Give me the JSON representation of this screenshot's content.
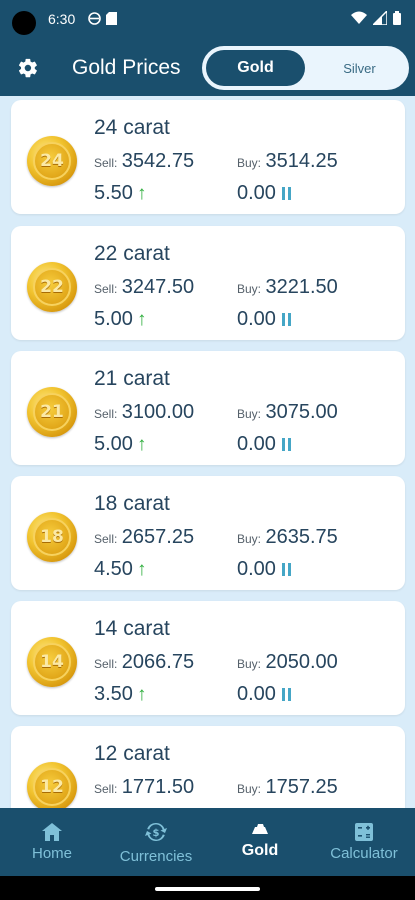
{
  "status_bar": {
    "time": "6:30"
  },
  "app_bar": {
    "title": "Gold Prices",
    "toggle": {
      "gold_label": "Gold",
      "silver_label": "Silver",
      "selected": "Gold"
    }
  },
  "items": [
    {
      "coin_label": "24",
      "title": "24 carat",
      "sell_label": "Sell:",
      "sell": "3542.75",
      "buy_label": "Buy:",
      "buy": "3514.25",
      "sell_change": "5.50",
      "buy_change": "0.00"
    },
    {
      "coin_label": "22",
      "title": "22 carat",
      "sell_label": "Sell:",
      "sell": "3247.50",
      "buy_label": "Buy:",
      "buy": "3221.50",
      "sell_change": "5.00",
      "buy_change": "0.00"
    },
    {
      "coin_label": "21",
      "title": "21 carat",
      "sell_label": "Sell:",
      "sell": "3100.00",
      "buy_label": "Buy:",
      "buy": "3075.00",
      "sell_change": "5.00",
      "buy_change": "0.00"
    },
    {
      "coin_label": "18",
      "title": "18 carat",
      "sell_label": "Sell:",
      "sell": "2657.25",
      "buy_label": "Buy:",
      "buy": "2635.75",
      "sell_change": "4.50",
      "buy_change": "0.00"
    },
    {
      "coin_label": "14",
      "title": "14 carat",
      "sell_label": "Sell:",
      "sell": "2066.75",
      "buy_label": "Buy:",
      "buy": "2050.00",
      "sell_change": "3.50",
      "buy_change": "0.00"
    },
    {
      "coin_label": "12",
      "title": "12 carat",
      "sell_label": "Sell:",
      "sell": "1771.50",
      "buy_label": "Buy:",
      "buy": "1757.25",
      "sell_change": "",
      "buy_change": ""
    }
  ],
  "bottom_nav": [
    {
      "label": "Home",
      "icon": "home-icon"
    },
    {
      "label": "Currencies",
      "icon": "currency-exchange-icon"
    },
    {
      "label": "Gold",
      "icon": "gold-bar-icon",
      "active": true
    },
    {
      "label": "Calculator",
      "icon": "calculator-icon"
    }
  ],
  "colors": {
    "primary": "#1a4f6d",
    "background": "#d9ecf9",
    "up": "#2fae3d",
    "steady": "#45a6c6"
  }
}
